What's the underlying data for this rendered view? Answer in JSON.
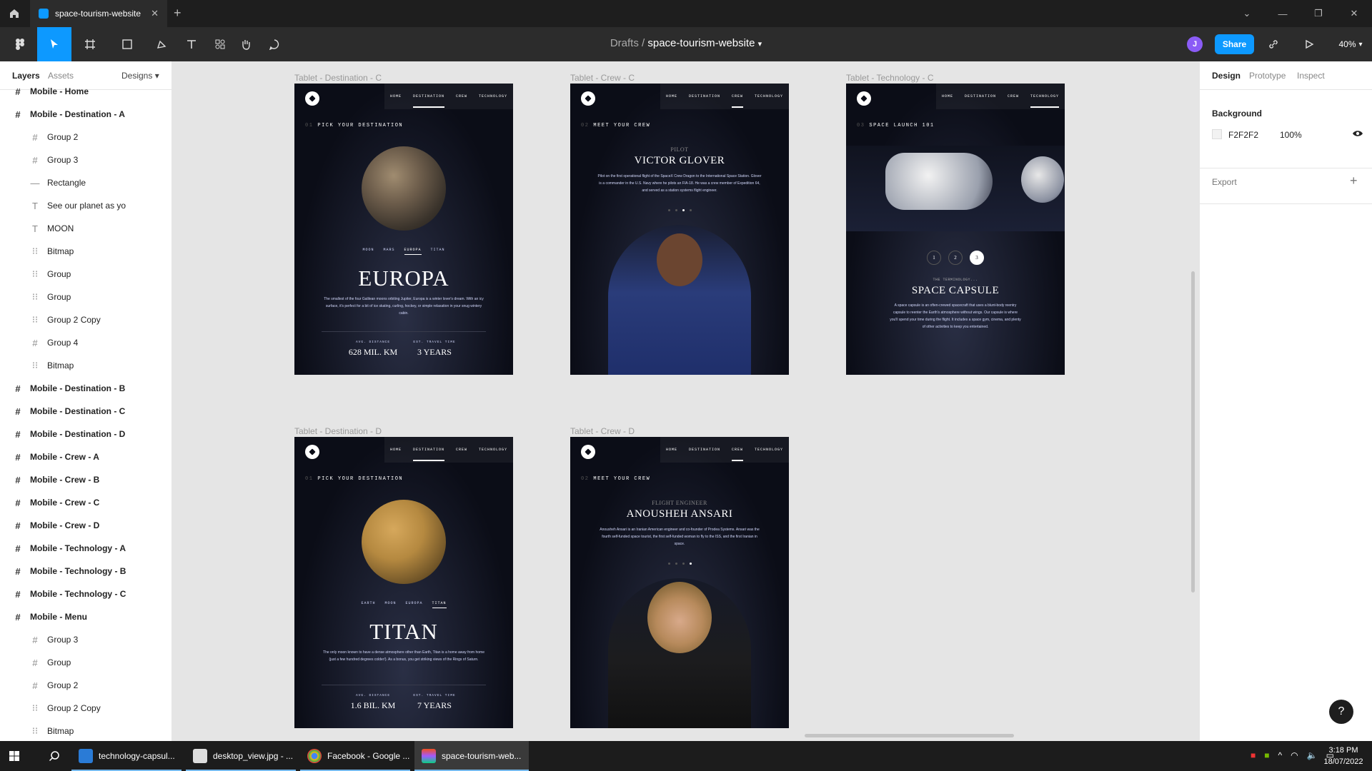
{
  "tab": {
    "title": "space-tourism-website"
  },
  "toolbar": {
    "breadcrumb_team": "Drafts",
    "breadcrumb_sep": "/",
    "file_name": "space-tourism-website",
    "avatar_initial": "J",
    "share_label": "Share",
    "zoom": "40%"
  },
  "left_panel": {
    "tabs": [
      "Layers",
      "Assets"
    ],
    "pages_label": "Designs",
    "layers": [
      {
        "label": "Mobile - Home",
        "kind": "frame",
        "level": 0
      },
      {
        "label": "Mobile - Destination - A",
        "kind": "frame",
        "level": 0
      },
      {
        "label": "Group 2",
        "kind": "frame",
        "level": 1
      },
      {
        "label": "Group 3",
        "kind": "frame",
        "level": 1
      },
      {
        "label": "Rectangle",
        "kind": "rect",
        "level": 1
      },
      {
        "label": "See our planet as yo",
        "kind": "text",
        "level": 1
      },
      {
        "label": "MOON",
        "kind": "text",
        "level": 1
      },
      {
        "label": "Bitmap",
        "kind": "group",
        "level": 1
      },
      {
        "label": "Group",
        "kind": "group",
        "level": 1
      },
      {
        "label": "Group",
        "kind": "group",
        "level": 1
      },
      {
        "label": "Group 2 Copy",
        "kind": "group",
        "level": 1
      },
      {
        "label": "Group 4",
        "kind": "frame",
        "level": 1
      },
      {
        "label": "Bitmap",
        "kind": "group",
        "level": 1
      },
      {
        "label": "Mobile - Destination - B",
        "kind": "frame",
        "level": 0
      },
      {
        "label": "Mobile - Destination - C",
        "kind": "frame",
        "level": 0
      },
      {
        "label": "Mobile - Destination - D",
        "kind": "frame",
        "level": 0
      },
      {
        "label": "Mobile - Crew - A",
        "kind": "frame",
        "level": 0
      },
      {
        "label": "Mobile - Crew - B",
        "kind": "frame",
        "level": 0
      },
      {
        "label": "Mobile - Crew - C",
        "kind": "frame",
        "level": 0
      },
      {
        "label": "Mobile - Crew - D",
        "kind": "frame",
        "level": 0
      },
      {
        "label": "Mobile - Technology - A",
        "kind": "frame",
        "level": 0
      },
      {
        "label": "Mobile - Technology - B",
        "kind": "frame",
        "level": 0
      },
      {
        "label": "Mobile - Technology - C",
        "kind": "frame",
        "level": 0
      },
      {
        "label": "Mobile - Menu",
        "kind": "frame",
        "level": 0
      },
      {
        "label": "Group 3",
        "kind": "frame",
        "level": 1
      },
      {
        "label": "Group",
        "kind": "frame",
        "level": 1
      },
      {
        "label": "Group 2",
        "kind": "frame",
        "level": 1
      },
      {
        "label": "Group 2 Copy",
        "kind": "group",
        "level": 1
      },
      {
        "label": "Bitmap",
        "kind": "group",
        "level": 1
      }
    ]
  },
  "frames": {
    "dest_c": {
      "label": "Tablet - Destination - C",
      "nav": [
        "HOME",
        "DESTINATION",
        "CREW",
        "TECHNOLOGY"
      ],
      "eyebrow_num": "01",
      "eyebrow": "PICK YOUR DESTINATION",
      "subnav": [
        "MOON",
        "MARS",
        "EUROPA",
        "TITAN"
      ],
      "title": "EUROPA",
      "desc": "The smallest of the four Galilean moons orbiting Jupiter, Europa is a winter lover's dream. With an icy surface, it's perfect for a bit of ice skating, curling, hockey, or simple relaxation in your snug wintery cabin.",
      "dist_label": "AVG. DISTANCE",
      "dist": "628 MIL. KM",
      "time_label": "EST. TRAVEL TIME",
      "time": "3 YEARS"
    },
    "crew_c": {
      "label": "Tablet - Crew - C",
      "nav": [
        "HOME",
        "DESTINATION",
        "CREW",
        "TECHNOLOGY"
      ],
      "eyebrow_num": "02",
      "eyebrow": "MEET YOUR CREW",
      "role": "PILOT",
      "name": "VICTOR GLOVER",
      "desc": "Pilot on the first operational flight of the SpaceX Crew Dragon to the International Space Station. Glover is a commander in the U.S. Navy where he pilots an F/A-18. He was a crew member of Expedition 64, and served as a station systems flight engineer."
    },
    "tech_c": {
      "label": "Tablet - Technology - C",
      "nav": [
        "HOME",
        "DESTINATION",
        "CREW",
        "TECHNOLOGY"
      ],
      "eyebrow_num": "03",
      "eyebrow": "SPACE LAUNCH 101",
      "steps": [
        "1",
        "2",
        "3"
      ],
      "kicker": "THE TERMINOLOGY...",
      "title": "SPACE CAPSULE",
      "desc": "A space capsule is an often-crewed spacecraft that uses a blunt-body reentry capsule to reenter the Earth's atmosphere without wings. Our capsule is where you'll spend your time during the flight. It includes a space gym, cinema, and plenty of other activities to keep you entertained."
    },
    "dest_d": {
      "label": "Tablet - Destination - D",
      "nav": [
        "HOME",
        "DESTINATION",
        "CREW",
        "TECHNOLOGY"
      ],
      "eyebrow_num": "01",
      "eyebrow": "PICK YOUR DESTINATION",
      "subnav": [
        "EARTH",
        "MOON",
        "EUROPA",
        "TITAN"
      ],
      "title": "TITAN",
      "desc": "The only moon known to have a dense atmosphere other than Earth, Titan is a home away from home (just a few hundred degrees colder!). As a bonus, you get striking views of the Rings of Saturn.",
      "dist_label": "AVG. DISTANCE",
      "dist": "1.6 BIL. KM",
      "time_label": "EST. TRAVEL TIME",
      "time": "7 YEARS"
    },
    "crew_d": {
      "label": "Tablet - Crew - D",
      "nav": [
        "HOME",
        "DESTINATION",
        "CREW",
        "TECHNOLOGY"
      ],
      "eyebrow_num": "02",
      "eyebrow": "MEET YOUR CREW",
      "role": "FLIGHT ENGINEER",
      "name": "ANOUSHEH ANSARI",
      "desc": "Anousheh Ansari is an Iranian American engineer and co-founder of Prodea Systems. Ansari was the fourth self-funded space tourist, the first self-funded woman to fly to the ISS, and the first Iranian in space."
    }
  },
  "right_panel": {
    "tabs": [
      "Design",
      "Prototype",
      "Inspect"
    ],
    "background_label": "Background",
    "bg_hex": "F2F2F2",
    "bg_opacity": "100%",
    "export_label": "Export",
    "export_add": "+"
  },
  "help_label": "?",
  "taskbar": {
    "apps": [
      "technology-capsul...",
      "desktop_view.jpg - ...",
      "Facebook - Google ...",
      "space-tourism-web..."
    ],
    "time": "3:18 PM",
    "date": "18/07/2022"
  },
  "colors": {
    "accent": "#0d99ff",
    "dark_bg": "#0b0d17",
    "avatar": "#8b5cf6"
  }
}
